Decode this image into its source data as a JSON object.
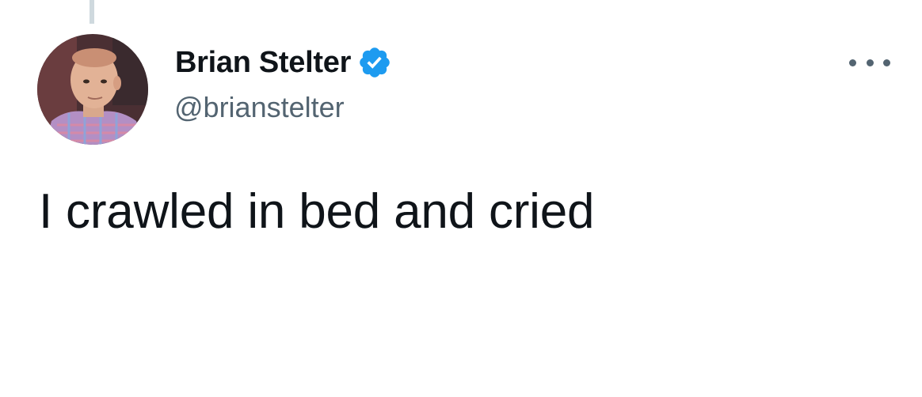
{
  "tweet": {
    "author": {
      "display_name": "Brian Stelter",
      "handle": "@brianstelter",
      "verified": true,
      "avatar_icon": "profile-photo"
    },
    "text": "I crawled in bed and cried",
    "more_icon": "more-options-icon"
  },
  "colors": {
    "background": "#ffffff",
    "primary_text": "#0f1419",
    "secondary_text": "#536471",
    "verified_badge": "#1d9bf0",
    "thread_line": "#cfd9de"
  }
}
